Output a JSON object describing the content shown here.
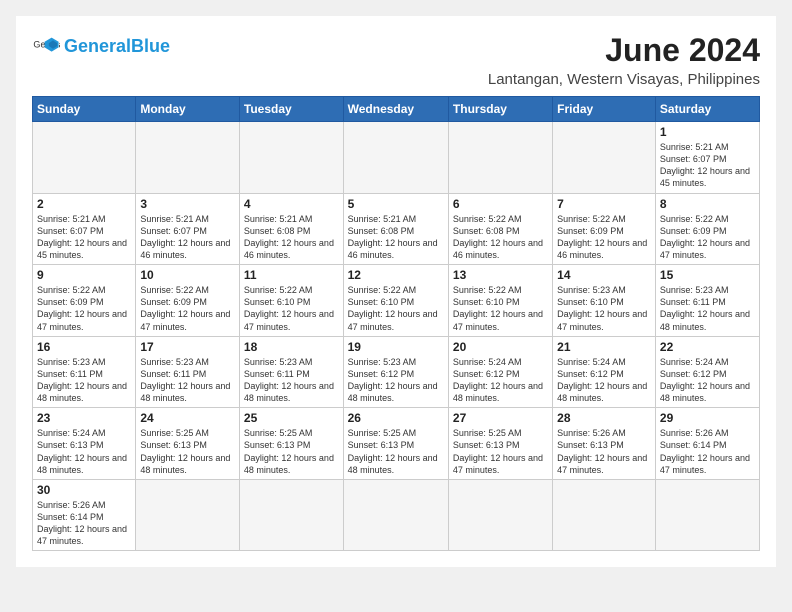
{
  "header": {
    "logo_general": "General",
    "logo_blue": "Blue",
    "month_title": "June 2024",
    "location": "Lantangan, Western Visayas, Philippines"
  },
  "days_of_week": [
    "Sunday",
    "Monday",
    "Tuesday",
    "Wednesday",
    "Thursday",
    "Friday",
    "Saturday"
  ],
  "weeks": [
    [
      {
        "day": null,
        "info": null
      },
      {
        "day": null,
        "info": null
      },
      {
        "day": null,
        "info": null
      },
      {
        "day": null,
        "info": null
      },
      {
        "day": null,
        "info": null
      },
      {
        "day": null,
        "info": null
      },
      {
        "day": "1",
        "info": "Sunrise: 5:21 AM\nSunset: 6:07 PM\nDaylight: 12 hours\nand 45 minutes."
      }
    ],
    [
      {
        "day": "2",
        "info": "Sunrise: 5:21 AM\nSunset: 6:07 PM\nDaylight: 12 hours\nand 45 minutes."
      },
      {
        "day": "3",
        "info": "Sunrise: 5:21 AM\nSunset: 6:07 PM\nDaylight: 12 hours\nand 46 minutes."
      },
      {
        "day": "4",
        "info": "Sunrise: 5:21 AM\nSunset: 6:08 PM\nDaylight: 12 hours\nand 46 minutes."
      },
      {
        "day": "5",
        "info": "Sunrise: 5:21 AM\nSunset: 6:08 PM\nDaylight: 12 hours\nand 46 minutes."
      },
      {
        "day": "6",
        "info": "Sunrise: 5:22 AM\nSunset: 6:08 PM\nDaylight: 12 hours\nand 46 minutes."
      },
      {
        "day": "7",
        "info": "Sunrise: 5:22 AM\nSunset: 6:09 PM\nDaylight: 12 hours\nand 46 minutes."
      },
      {
        "day": "8",
        "info": "Sunrise: 5:22 AM\nSunset: 6:09 PM\nDaylight: 12 hours\nand 47 minutes."
      }
    ],
    [
      {
        "day": "9",
        "info": "Sunrise: 5:22 AM\nSunset: 6:09 PM\nDaylight: 12 hours\nand 47 minutes."
      },
      {
        "day": "10",
        "info": "Sunrise: 5:22 AM\nSunset: 6:09 PM\nDaylight: 12 hours\nand 47 minutes."
      },
      {
        "day": "11",
        "info": "Sunrise: 5:22 AM\nSunset: 6:10 PM\nDaylight: 12 hours\nand 47 minutes."
      },
      {
        "day": "12",
        "info": "Sunrise: 5:22 AM\nSunset: 6:10 PM\nDaylight: 12 hours\nand 47 minutes."
      },
      {
        "day": "13",
        "info": "Sunrise: 5:22 AM\nSunset: 6:10 PM\nDaylight: 12 hours\nand 47 minutes."
      },
      {
        "day": "14",
        "info": "Sunrise: 5:23 AM\nSunset: 6:10 PM\nDaylight: 12 hours\nand 47 minutes."
      },
      {
        "day": "15",
        "info": "Sunrise: 5:23 AM\nSunset: 6:11 PM\nDaylight: 12 hours\nand 48 minutes."
      }
    ],
    [
      {
        "day": "16",
        "info": "Sunrise: 5:23 AM\nSunset: 6:11 PM\nDaylight: 12 hours\nand 48 minutes."
      },
      {
        "day": "17",
        "info": "Sunrise: 5:23 AM\nSunset: 6:11 PM\nDaylight: 12 hours\nand 48 minutes."
      },
      {
        "day": "18",
        "info": "Sunrise: 5:23 AM\nSunset: 6:11 PM\nDaylight: 12 hours\nand 48 minutes."
      },
      {
        "day": "19",
        "info": "Sunrise: 5:23 AM\nSunset: 6:12 PM\nDaylight: 12 hours\nand 48 minutes."
      },
      {
        "day": "20",
        "info": "Sunrise: 5:24 AM\nSunset: 6:12 PM\nDaylight: 12 hours\nand 48 minutes."
      },
      {
        "day": "21",
        "info": "Sunrise: 5:24 AM\nSunset: 6:12 PM\nDaylight: 12 hours\nand 48 minutes."
      },
      {
        "day": "22",
        "info": "Sunrise: 5:24 AM\nSunset: 6:12 PM\nDaylight: 12 hours\nand 48 minutes."
      }
    ],
    [
      {
        "day": "23",
        "info": "Sunrise: 5:24 AM\nSunset: 6:13 PM\nDaylight: 12 hours\nand 48 minutes."
      },
      {
        "day": "24",
        "info": "Sunrise: 5:25 AM\nSunset: 6:13 PM\nDaylight: 12 hours\nand 48 minutes."
      },
      {
        "day": "25",
        "info": "Sunrise: 5:25 AM\nSunset: 6:13 PM\nDaylight: 12 hours\nand 48 minutes."
      },
      {
        "day": "26",
        "info": "Sunrise: 5:25 AM\nSunset: 6:13 PM\nDaylight: 12 hours\nand 48 minutes."
      },
      {
        "day": "27",
        "info": "Sunrise: 5:25 AM\nSunset: 6:13 PM\nDaylight: 12 hours\nand 47 minutes."
      },
      {
        "day": "28",
        "info": "Sunrise: 5:26 AM\nSunset: 6:13 PM\nDaylight: 12 hours\nand 47 minutes."
      },
      {
        "day": "29",
        "info": "Sunrise: 5:26 AM\nSunset: 6:14 PM\nDaylight: 12 hours\nand 47 minutes."
      }
    ],
    [
      {
        "day": "30",
        "info": "Sunrise: 5:26 AM\nSunset: 6:14 PM\nDaylight: 12 hours\nand 47 minutes."
      },
      {
        "day": null,
        "info": null
      },
      {
        "day": null,
        "info": null
      },
      {
        "day": null,
        "info": null
      },
      {
        "day": null,
        "info": null
      },
      {
        "day": null,
        "info": null
      },
      {
        "day": null,
        "info": null
      }
    ]
  ]
}
